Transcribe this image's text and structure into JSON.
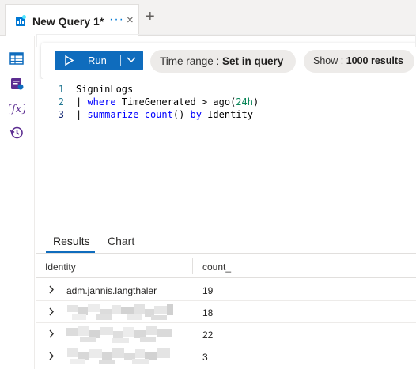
{
  "tab": {
    "title": "New Query 1*",
    "more_label": "···",
    "close_label": "×",
    "add_label": "+"
  },
  "toolbar": {
    "run_label": "Run",
    "time_range_label": "Time range :",
    "time_range_value": "Set in query",
    "show_label": "Show :",
    "show_value": "1000 results"
  },
  "editor": {
    "lines": [
      {
        "num": "1",
        "text": "SigninLogs"
      },
      {
        "num": "2",
        "text": "| where TimeGenerated > ago(24h)"
      },
      {
        "num": "3",
        "text": "| summarize count() by Identity"
      }
    ]
  },
  "results": {
    "tabs": [
      "Results",
      "Chart"
    ],
    "active_tab": "Results",
    "columns": [
      "Identity",
      "count_"
    ],
    "rows": [
      {
        "identity": "adm.jannis.langthaler",
        "count": "19",
        "redacted": false
      },
      {
        "identity": "",
        "count": "18",
        "redacted": true
      },
      {
        "identity": "",
        "count": "22",
        "redacted": true
      },
      {
        "identity": "",
        "count": "3",
        "redacted": true
      }
    ]
  },
  "colors": {
    "accent": "#0f6cbd",
    "keyword": "#0000ff",
    "number": "#098658",
    "line_number": "#237893"
  }
}
